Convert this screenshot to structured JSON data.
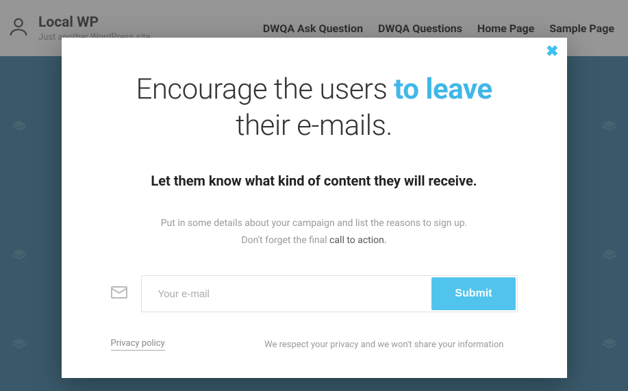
{
  "header": {
    "site_title": "Local WP",
    "tagline": "Just another WordPress site",
    "nav": [
      {
        "label": "DWQA Ask Question"
      },
      {
        "label": "DWQA Questions"
      },
      {
        "label": "Home Page"
      },
      {
        "label": "Sample Page"
      }
    ]
  },
  "modal": {
    "headline_pre": "Encourage the users ",
    "headline_highlight": "to leave",
    "headline_post": " their e-mails.",
    "subheading": "Let them know what kind of content they will receive.",
    "desc_line1": "Put in some details about your campaign and list the reasons to sign up.",
    "desc_line2_pre": "Don't forget the final ",
    "desc_line2_cta": "call to action.",
    "email_placeholder": "Your e-mail",
    "email_value": "",
    "submit_label": "Submit",
    "privacy_link": "Privacy policy",
    "privacy_note": "We respect your privacy and we won't share your information"
  },
  "colors": {
    "accent": "#41b7e8",
    "hero_bg": "#176891"
  }
}
